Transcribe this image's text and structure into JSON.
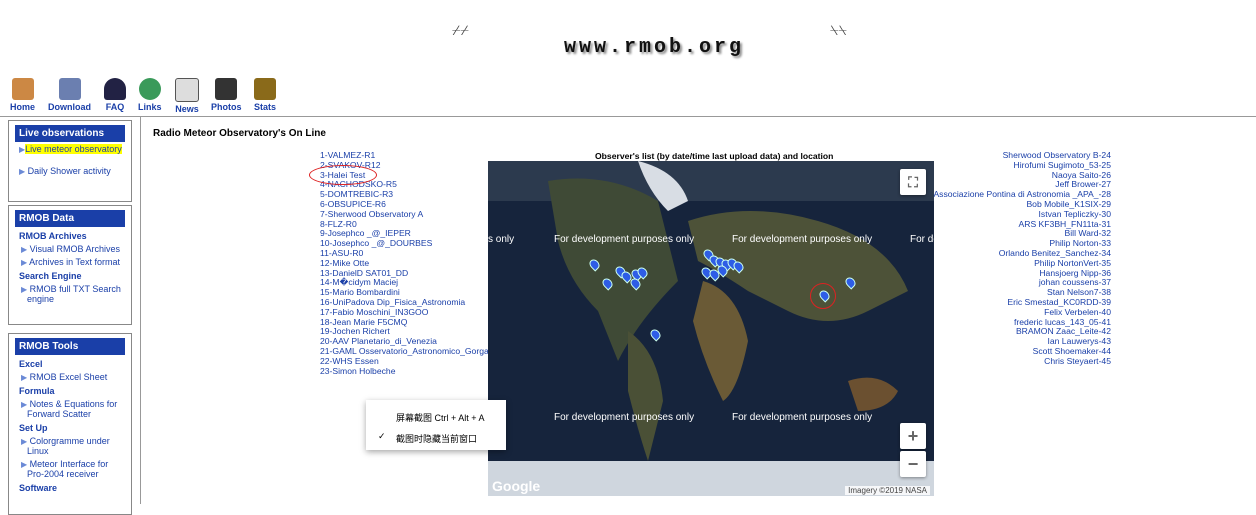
{
  "header": {
    "title": "www.rmob.org"
  },
  "nav": [
    {
      "label": "Home",
      "icon": "home-icon"
    },
    {
      "label": "Download",
      "icon": "download-icon"
    },
    {
      "label": "FAQ",
      "icon": "faq-icon"
    },
    {
      "label": "Links",
      "icon": "links-icon"
    },
    {
      "label": "News",
      "icon": "news-icon"
    },
    {
      "label": "Photos",
      "icon": "photos-icon"
    },
    {
      "label": "Stats",
      "icon": "stats-icon"
    }
  ],
  "sidebar": {
    "live": {
      "title": "Live observations",
      "items": [
        "Live meteor observatory",
        "Daily Shower activity"
      ]
    },
    "data": {
      "title": "RMOB Data",
      "archives": "RMOB Archives",
      "archive_items": [
        "Visual RMOB Archives",
        "Archives in Text format"
      ],
      "search": "Search Engine",
      "search_items": [
        "RMOB full TXT Search engine"
      ]
    },
    "tools": {
      "title": "RMOB Tools",
      "excel": "Excel",
      "excel_items": [
        "RMOB Excel Sheet"
      ],
      "formula": "Formula",
      "formula_items": [
        "Notes & Equations for Forward Scatter"
      ],
      "setup": "Set Up",
      "setup_items": [
        "Colorgramme under Linux",
        "Meteor Interface for Pro-2004 receiver"
      ],
      "software": "Software"
    }
  },
  "main": {
    "title": "Radio Meteor Observatory's On Line",
    "map_caption": "Observer's list (by date/time last upload data) and location",
    "left_list": [
      "1-VALMEZ-R1",
      "2-SVAKOV-R12",
      "3-Halei Test",
      "4-NACHODSKO-R5",
      "5-DOMTREBIC-R3",
      "6-OBSUPICE-R6",
      "7-Sherwood Observatory A",
      "8-FLZ-R0",
      "9-Josephco _@_IEPER",
      "10-Josephco _@_DOURBES",
      "11-ASU-R0",
      "12-Mike Otte",
      "13-DanielD SAT01_DD",
      "14-M�cidym Maciej",
      "15-Mario Bombardini",
      "16-UniPadova Dip_Fisica_Astronomia",
      "17-Fabio Moschini_IN3GOO",
      "18-Jean Marie F5CMQ",
      "19-Jochen Richert",
      "20-AAV Planetario_di_Venezia",
      "21-GAML Osservatorio_Astronomico_Gorga",
      "22-WHS Essen",
      "23-Simon Holbeche"
    ],
    "right_list": [
      "Sherwood Observatory B-24",
      "Hirofumi Sugimoto_53-25",
      "Naoya Saito-26",
      "Jeff Brower-27",
      "Associazione Pontina di Astronomia _APA_-28",
      "Bob Mobile_K1SIX-29",
      "Istvan Tepliczky-30",
      "ARS KF3BH_FN11ta-31",
      "Bill Ward-32",
      "Philip Norton-33",
      "Orlando Benitez_Sanchez-34",
      "Philip NortonVert-35",
      "Hansjoerg Nipp-36",
      "johan coussens-37",
      "Stan Nelson7-38",
      "Eric Smestad_KC0RDD-39",
      "Felix Verbelen-40",
      "frederic lucas_143_05-41",
      "BRAMON Zaac_Leite-42",
      "Ian Lauwerys-43",
      "Scott Shoemaker-44",
      "Chris Steyaert-45"
    ]
  },
  "map": {
    "watermark": "For development purposes only",
    "watermark_top": [
      "s only",
      "For development purposes only",
      "For development purposes only",
      "For de"
    ],
    "watermark_bottom": [
      "For development purposes only",
      "For development purposes only"
    ],
    "zoom_in": "+",
    "zoom_out": "−",
    "fullscreen": "⛶",
    "logo": "Google",
    "attribution": "Imagery ©2019 NASA"
  },
  "context_menu": {
    "item1": "屏幕截图 Ctrl + Alt + A",
    "item2": "截图时隐藏当前窗口",
    "check": "✓"
  }
}
